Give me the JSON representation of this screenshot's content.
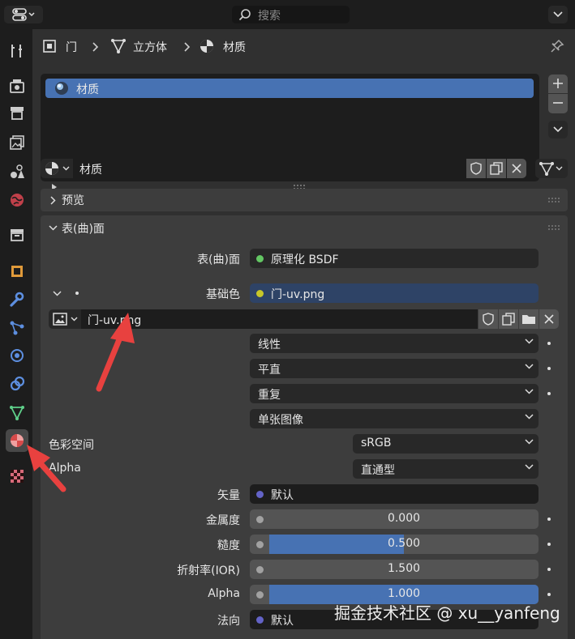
{
  "header": {
    "search_placeholder": "搜索"
  },
  "breadcrumb": {
    "object": "门",
    "mesh": "立方体",
    "material": "材质"
  },
  "material_slots": {
    "items": [
      "材质"
    ]
  },
  "material_selector": {
    "name": "材质"
  },
  "panels": {
    "preview": "预览",
    "surface": "表(曲)面"
  },
  "surface": {
    "surface_label": "表(曲)面",
    "surface_value": "原理化 BSDF",
    "base_color_label": "基础色",
    "base_color_value": "门-uv.png",
    "image_name": "门-uv.png",
    "interpolation": "线性",
    "projection": "平直",
    "extension": "重复",
    "source": "单张图像",
    "color_space_label": "色彩空间",
    "color_space_value": "sRGB",
    "alpha_label": "Alpha",
    "alpha_mode": "直通型",
    "vector_label": "矢量",
    "vector_value": "默认",
    "metallic_label": "金属度",
    "metallic_value": "0.000",
    "roughness_label": "糙度",
    "roughness_value": "0.500",
    "ior_label": "折射率(IOR)",
    "ior_value": "1.500",
    "alpha2_label": "Alpha",
    "alpha2_value": "1.000",
    "normal_label": "法向",
    "normal_value": "默认"
  },
  "levels": {
    "roughness": 0.5,
    "alpha": 1.0,
    "metallic": 0.0
  },
  "watermark": "掘金技术社区 @ xu__yanfeng",
  "colors": {
    "accent": "#4772b3",
    "arrow": "#e8413f",
    "socket_green": "#63c763",
    "socket_yellow": "#c7c729",
    "socket_purple": "#6363c7",
    "socket_gray": "#a1a1a1"
  }
}
